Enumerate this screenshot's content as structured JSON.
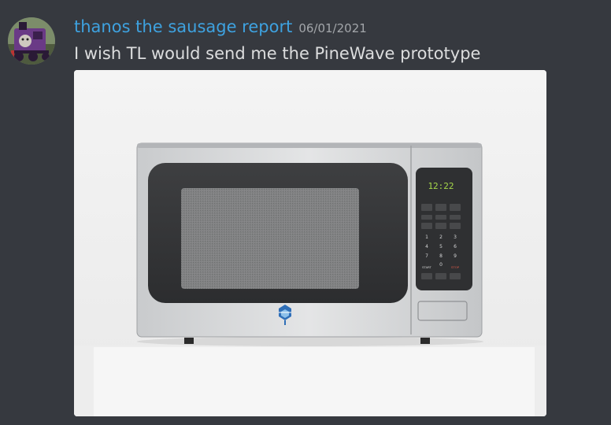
{
  "message": {
    "username": "thanos the sausage report",
    "timestamp": "06/01/2021",
    "content": "I wish TL would send me the PineWave prototype"
  },
  "avatar": {
    "icon": "train-engine-avatar",
    "accent_color": "#6a3a86"
  },
  "attachment": {
    "subject": "microwave-oven-photo",
    "clock_display": "12:22",
    "keypad_labels": [
      "1",
      "2",
      "3",
      "4",
      "5",
      "6",
      "7",
      "8",
      "9",
      "0"
    ],
    "start_label": "START",
    "stop_label": "STOP",
    "display_color": "#a6d84a",
    "logo_color": "#2f6fb8"
  },
  "colors": {
    "background": "#36393f",
    "username": "#3ea2e0",
    "text": "#dcddde",
    "timestamp": "#a3a6aa"
  }
}
